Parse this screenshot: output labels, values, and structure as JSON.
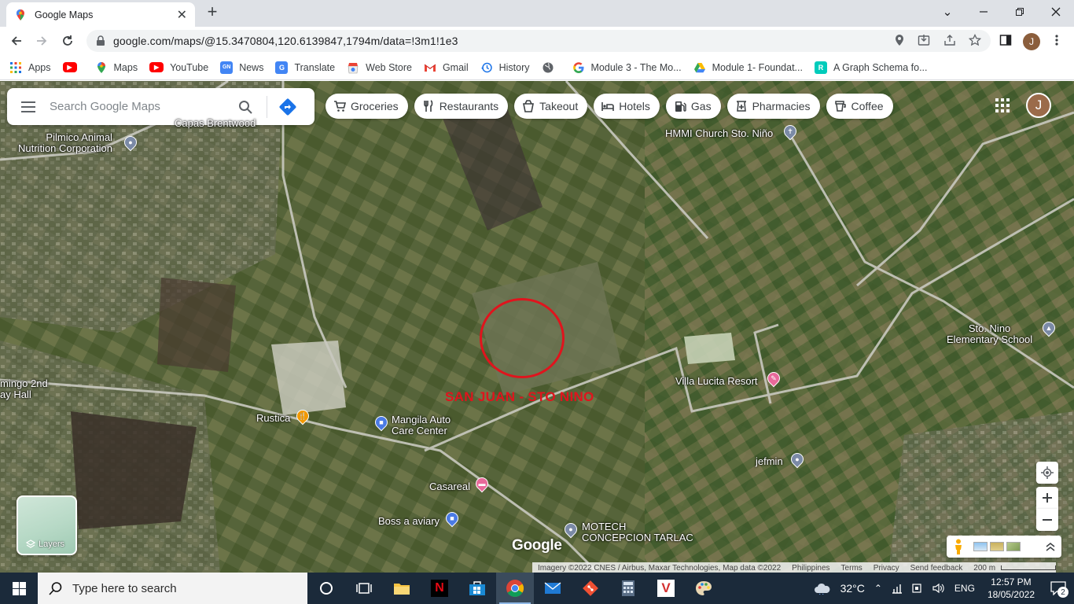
{
  "browser": {
    "tab_title": "Google Maps",
    "url": "google.com/maps/@15.3470804,120.6139847,1794m/data=!3m1!1e3",
    "bookmarks": [
      {
        "label": "Apps",
        "icon": "apps-grid-icon"
      },
      {
        "label": "",
        "icon": "youtube-icon"
      },
      {
        "label": "Maps",
        "icon": "maps-pin-icon"
      },
      {
        "label": "YouTube",
        "icon": "youtube-icon"
      },
      {
        "label": "News",
        "icon": "google-news-icon"
      },
      {
        "label": "Translate",
        "icon": "translate-icon"
      },
      {
        "label": "Web Store",
        "icon": "web-store-icon"
      },
      {
        "label": "Gmail",
        "icon": "gmail-icon"
      },
      {
        "label": "History",
        "icon": "history-icon"
      },
      {
        "label": "",
        "icon": "globe-icon"
      },
      {
        "label": "Module 3 - The Mo...",
        "icon": "google-g-icon"
      },
      {
        "label": "Module 1- Foundat...",
        "icon": "google-drive-icon"
      },
      {
        "label": "A Graph Schema fo...",
        "icon": "researchgate-icon"
      }
    ],
    "profile_initial": "J"
  },
  "maps": {
    "search_placeholder": "Search Google Maps",
    "chips": [
      {
        "label": "Groceries",
        "icon": "cart-icon"
      },
      {
        "label": "Restaurants",
        "icon": "fork-knife-icon"
      },
      {
        "label": "Takeout",
        "icon": "takeout-icon"
      },
      {
        "label": "Hotels",
        "icon": "bed-icon"
      },
      {
        "label": "Gas",
        "icon": "gas-pump-icon"
      },
      {
        "label": "Pharmacies",
        "icon": "pharmacy-icon"
      },
      {
        "label": "Coffee",
        "icon": "coffee-icon"
      }
    ],
    "profile_initial": "J",
    "places": {
      "pilmico": "Pilmico Animal\nNutrition Corporation",
      "capas": "Capas Brentwood",
      "hmmi": "HMMI Church Sto. Niño",
      "sto_nino_school": "Sto. Nino\nElementary School",
      "villa_lucita": "Villa Lucita Resort",
      "rustica": "Rustica",
      "mangila": "Mangila Auto\nCare Center",
      "jefmin": "jefmin",
      "casareal": "Casareal",
      "boss_aviary": "Boss a aviary",
      "motech": "MOTECH\nCONCEPCION TARLAC",
      "hall": "mingo 2nd\nay Hall"
    },
    "annotation": "SAN JUAN - STO NINO",
    "layers_label": "Layers",
    "logo": "Google",
    "attribution": {
      "imagery": "Imagery ©2022 CNES / Airbus, Maxar Technologies, Map data ©2022",
      "country": "Philippines",
      "terms": "Terms",
      "privacy": "Privacy",
      "feedback": "Send feedback",
      "scale": "200 m"
    }
  },
  "taskbar": {
    "search_placeholder": "Type here to search",
    "temperature": "32°C",
    "language": "ENG",
    "time": "12:57 PM",
    "date": "18/05/2022",
    "notifications": "2"
  },
  "colors": {
    "annotation_red": "#e0141d",
    "maps_blue": "#1a73e8",
    "taskbar_bg": "#1b2a3a"
  }
}
